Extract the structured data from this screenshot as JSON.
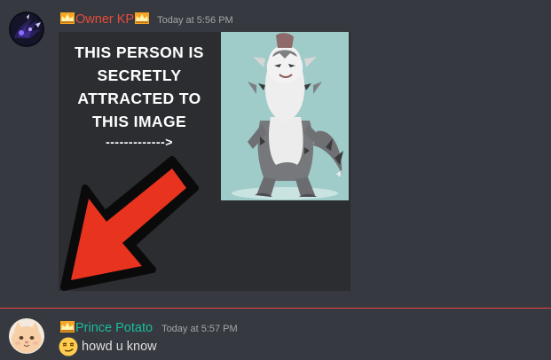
{
  "messages": [
    {
      "author": "Owner KP",
      "author_color": "#e74c3c",
      "author_badge_icon": "crown-icon",
      "avatar_icon": "dark-purple-creature-avatar",
      "timestamp": "Today at 5:56 PM",
      "attachment": {
        "type": "meme-image",
        "text_lines": [
          "THIS PERSON IS",
          "SECRETLY",
          "ATTRACTED TO",
          "THIS IMAGE"
        ],
        "arrow_text": "------------->",
        "pointer_icon": "red-arrow-icon",
        "character_icon": "gray-anthro-creature-drawing"
      }
    },
    {
      "author": "Prince Potato",
      "author_color": "#1abc9c",
      "author_badge_icon": "crown-icon",
      "avatar_icon": "potato-cat-avatar",
      "timestamp": "Today at 5:57 PM",
      "content_emoji": "smirk-emoji",
      "content": "howd u know"
    }
  ],
  "new_messages_divider_color": "#ed4245"
}
